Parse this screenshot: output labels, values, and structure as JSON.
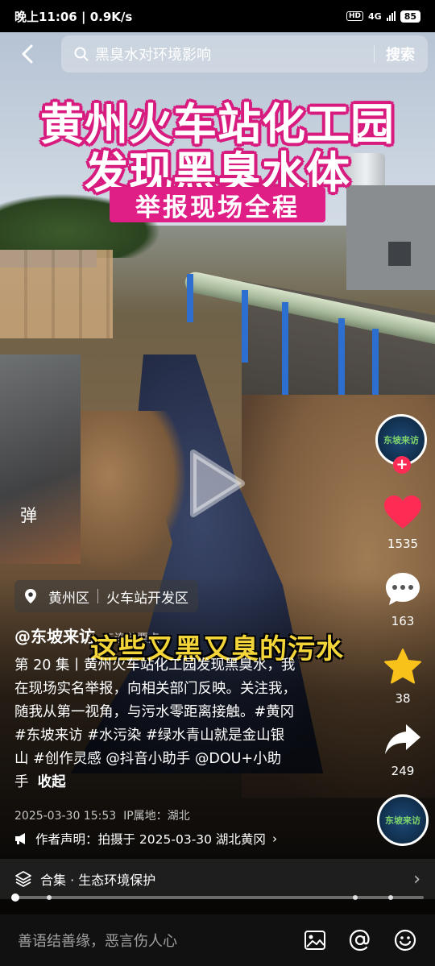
{
  "status": {
    "time": "晚上11:06",
    "speed": "0.9K/s",
    "hd": "HD",
    "network": "4G",
    "battery": "85"
  },
  "search": {
    "query": "黑臭水对环境影响",
    "button": "搜索"
  },
  "video": {
    "title_line1": "黄州火车站化工园",
    "title_line2": "发现黑臭水体",
    "title_badge": "举报现场全程",
    "caption": "这些又黑又臭的污水",
    "danmu": "弹"
  },
  "actions": {
    "likes": "1535",
    "comments": "163",
    "favorites": "38",
    "shares": "249",
    "avatar_text": "东坡来访"
  },
  "location": {
    "district": "黄州区",
    "place": "火车站开发区"
  },
  "post": {
    "author": "@东坡来访",
    "author_extra": "三连节要点",
    "description_line1": "第 20 集丨黄州火车站化工园发现黑臭水，我",
    "description_line2": "在现场实名举报，向相关部门反映。关注我，",
    "description_line3": "随我从第一视角，与污水零距离接触。#黄冈",
    "description_line4": "#东坡来访 #水污染 #绿水青山就是金山银",
    "description_line5": "山 #创作灵感 @抖音小助手 @DOU+小助",
    "description_line6": "手",
    "collapse": "收起",
    "datetime": "2025-03-30 15:53",
    "ip": "IP属地：湖北",
    "declaration": "作者声明：拍摄于 2025-03-30 湖北黄冈"
  },
  "collection": {
    "label": "合集 · 生态环境保护"
  },
  "progress": {
    "played_fraction": 0.0
  },
  "comment_bar": {
    "placeholder": "善语结善缘，恶言伤人心"
  }
}
